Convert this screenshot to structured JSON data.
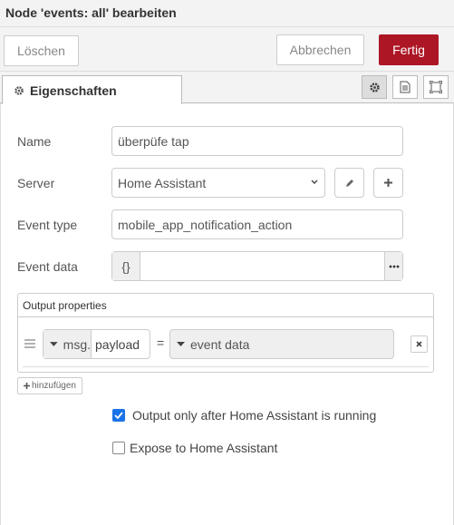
{
  "dialog": {
    "title": "Node 'events: all' bearbeiten"
  },
  "toolbar": {
    "delete_label": "Löschen",
    "cancel_label": "Abbrechen",
    "done_label": "Fertig"
  },
  "tabs": {
    "properties_label": "Eigenschaften"
  },
  "form": {
    "name_label": "Name",
    "name_value": "überpüfe tap",
    "server_label": "Server",
    "server_value": "Home Assistant",
    "event_type_label": "Event type",
    "event_type_value": "mobile_app_notification_action",
    "event_data_label": "Event data",
    "event_data_prefix": "{}",
    "event_data_value": ""
  },
  "output": {
    "header": "Output properties",
    "rows": [
      {
        "msg_prefix": "msg.",
        "msg_value": "payload",
        "equals": "=",
        "value_label": "event data"
      }
    ],
    "add_label": "hinzufügen"
  },
  "options": {
    "output_after_running_label": "Output only after Home Assistant is running",
    "output_after_running_checked": true,
    "expose_label": "Expose to Home Assistant",
    "expose_checked": false
  },
  "colors": {
    "accent": "#ad1625",
    "checkbox": "#1a73e8"
  }
}
